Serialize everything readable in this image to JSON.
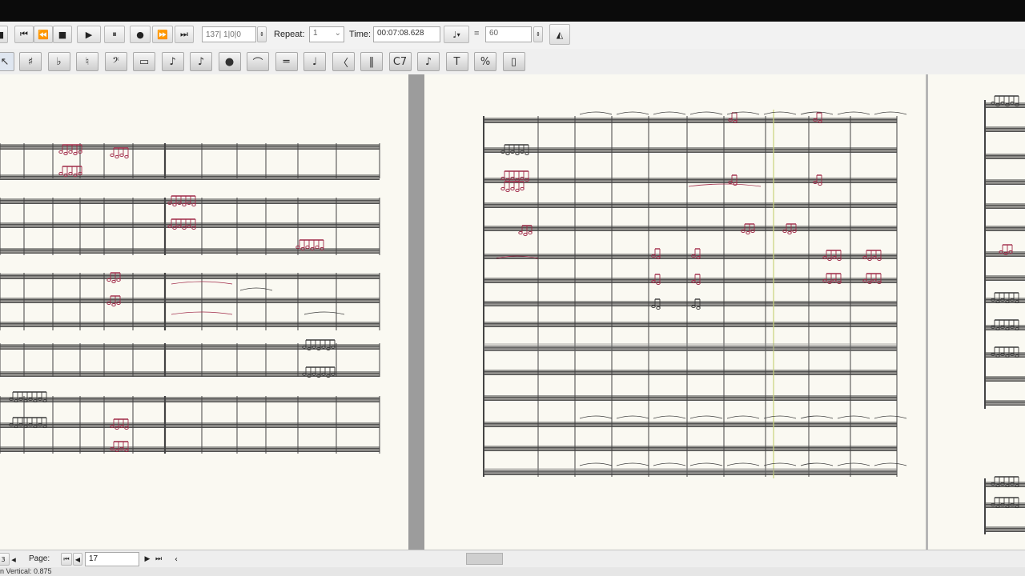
{
  "transport": {
    "position_placeholder": "137| 1|0|0",
    "repeat_label": "Repeat:",
    "repeat_value": "1",
    "time_label": "Time:",
    "time_value": "00:07:08.628",
    "tempo_separator": "=",
    "tempo_value": "60"
  },
  "tools": [
    {
      "name": "select-arrow-tool",
      "glyph": "↖"
    },
    {
      "name": "sharp-tool",
      "glyph": "♯"
    },
    {
      "name": "flat-tool",
      "glyph": "♭"
    },
    {
      "name": "natural-tool",
      "glyph": "♮"
    },
    {
      "name": "clef-tool",
      "glyph": "𝄢"
    },
    {
      "name": "rest-tool",
      "glyph": "▭"
    },
    {
      "name": "note-tool",
      "glyph": "♪"
    },
    {
      "name": "grace-note-tool",
      "glyph": "♪"
    },
    {
      "name": "dynamics-tool",
      "glyph": "●"
    },
    {
      "name": "slur-tool",
      "glyph": "⌒"
    },
    {
      "name": "beam-tool",
      "glyph": "═"
    },
    {
      "name": "articulation-tool",
      "glyph": "♩"
    },
    {
      "name": "hairpin-tool",
      "glyph": "〈"
    },
    {
      "name": "barline-tool",
      "glyph": "‖"
    },
    {
      "name": "chord-symbol-tool",
      "glyph": "C7"
    },
    {
      "name": "lyrics-tool",
      "glyph": "♪"
    },
    {
      "name": "text-tool",
      "glyph": "T"
    },
    {
      "name": "percent-tool",
      "glyph": "%"
    },
    {
      "name": "page-tool",
      "glyph": "▯"
    }
  ],
  "status": {
    "page_label": "Page:",
    "page_value": "17",
    "zoom_text": "n Vertical: 0.875"
  },
  "colors": {
    "note_ink": "#a02a48",
    "staff_ink": "#3a3a3a",
    "playback_cursor": "#c8d27a"
  }
}
